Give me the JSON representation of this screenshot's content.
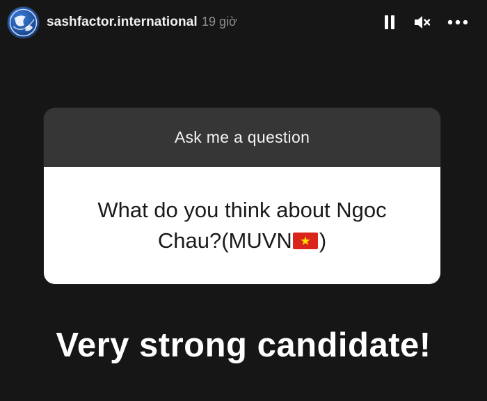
{
  "header": {
    "username": "sashfactor.international",
    "time_ago": "19 giờ",
    "avatar_icon": "globe-logo-icon",
    "controls": {
      "pause_icon": "pause-icon",
      "mute_icon": "speaker-muted-icon",
      "more_icon": "more-horizontal-icon"
    }
  },
  "question_card": {
    "prompt": "Ask me a question",
    "question_line1": "What do you think about Ngoc",
    "question_line2_before_flag": "Chau?(MUVN",
    "question_line2_after_flag": ")",
    "flag_icon": "vietnam-flag-emoji"
  },
  "answer": "Very strong candidate!",
  "colors": {
    "background": "#161616",
    "card_header": "#363636",
    "card_body": "#ffffff",
    "time_text": "#8e8e8e",
    "flag_red": "#da251d",
    "flag_star": "#ffde00"
  }
}
